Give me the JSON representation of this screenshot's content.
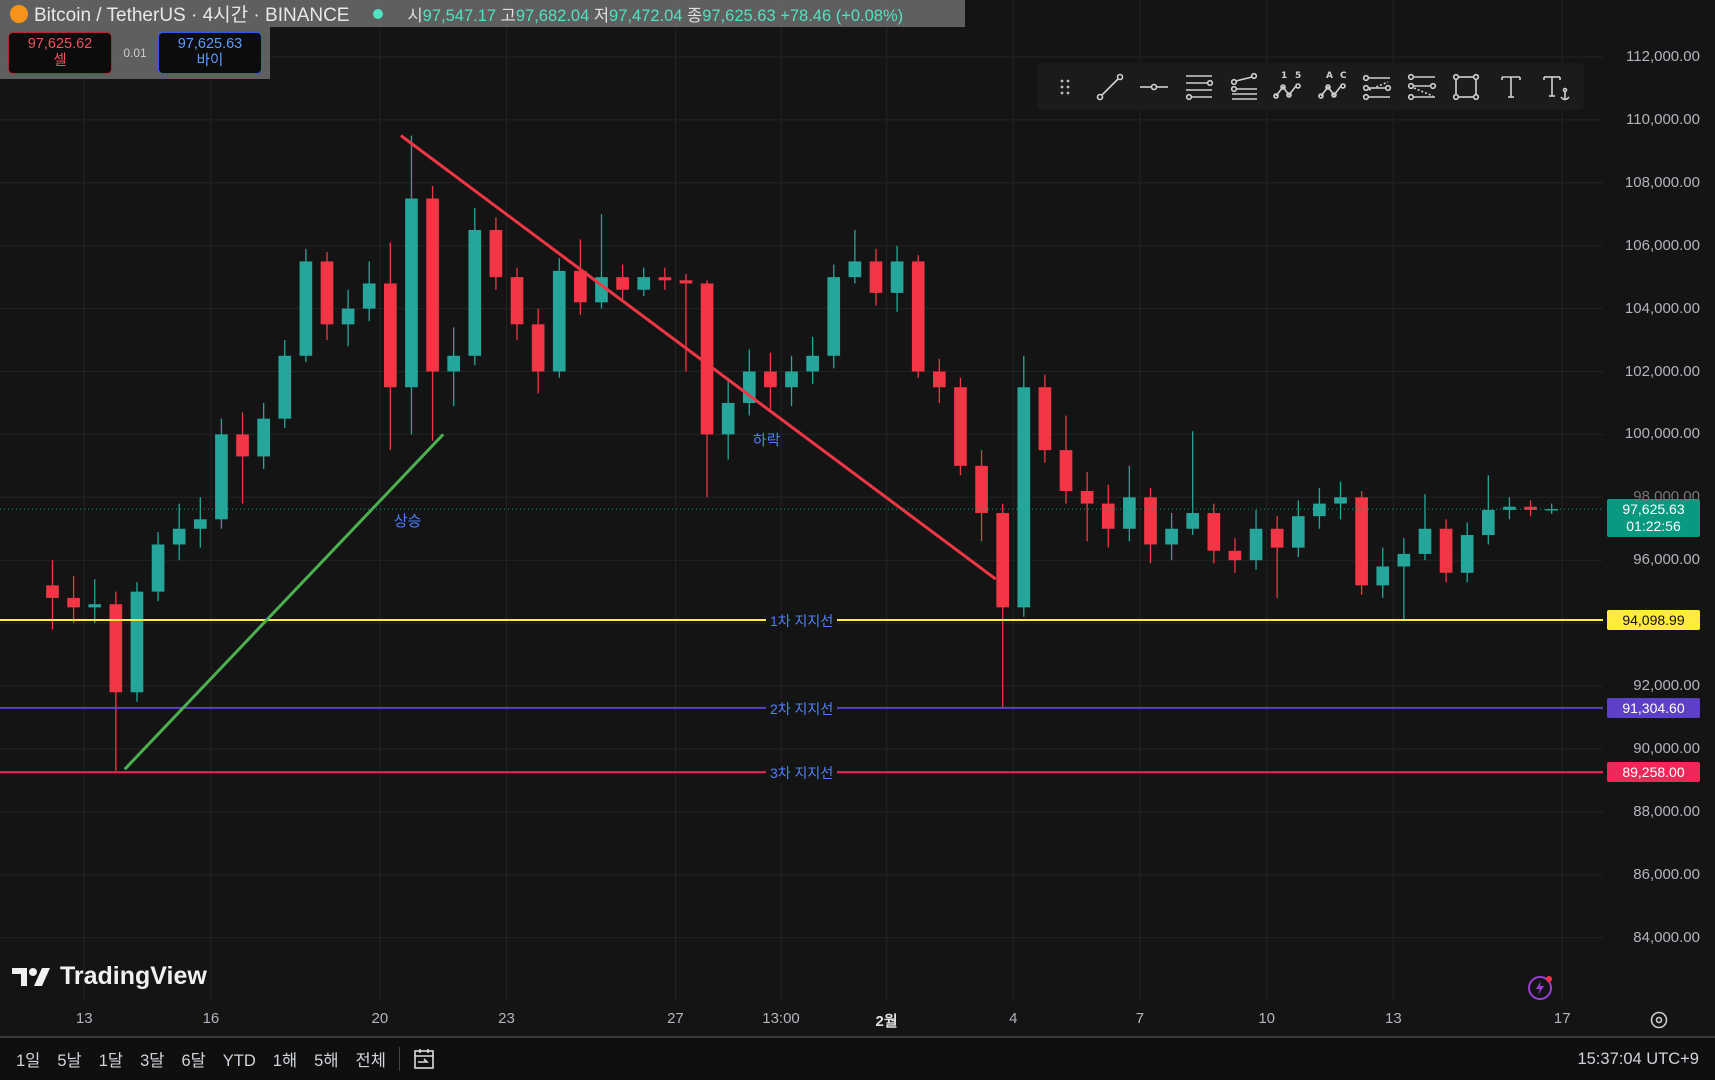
{
  "header": {
    "symbol": "Bitcoin / TetherUS · 4시간 · BINANCE",
    "o_label": "시",
    "o": "97,547.17",
    "h_label": "고",
    "h": "97,682.04",
    "l_label": "저",
    "l": "97,472.04",
    "c_label": "종",
    "c": "97,625.63",
    "change": "+78.46 (+0.08%)"
  },
  "trade": {
    "sell_price": "97,625.62",
    "sell_label": "셀",
    "spread": "0.01",
    "buy_price": "97,625.63",
    "buy_label": "바이"
  },
  "toolbar": {
    "icons": [
      "drag-handle-icon",
      "trend-line-icon",
      "horizontal-ray-icon",
      "parallel-channel-icon",
      "fib-retracement-icon",
      "elliott-wave-icon",
      "abcd-pattern-icon",
      "long-position-icon",
      "short-position-icon",
      "rectangle-icon",
      "text-icon",
      "anchored-text-icon"
    ]
  },
  "chart_data": {
    "type": "candlestick",
    "symbol": "BTCUSDT",
    "interval": "4시간",
    "ylim": [
      83000,
      113000
    ],
    "y_ticks": [
      "112,000.00",
      "110,000.00",
      "108,000.00",
      "106,000.00",
      "104,000.00",
      "102,000.00",
      "100,000.00",
      "98,000.00",
      "96,000.00",
      "92,000.00",
      "90,000.00",
      "88,000.00",
      "86,000.00",
      "84,000.00"
    ],
    "y_tick_values": [
      112000,
      110000,
      108000,
      106000,
      104000,
      102000,
      100000,
      98000,
      96000,
      92000,
      90000,
      88000,
      86000,
      84000
    ],
    "x_ticks": [
      {
        "label": "13",
        "date": "01-13 00:00"
      },
      {
        "label": "16",
        "date": "01-16 00:00"
      },
      {
        "label": "20",
        "date": "01-20 00:00"
      },
      {
        "label": "23",
        "date": "01-23 00:00"
      },
      {
        "label": "27",
        "date": "01-27 00:00"
      },
      {
        "label": "13:00",
        "date": "01-29 12:00"
      },
      {
        "label": "2월",
        "date": "02-01 00:00"
      },
      {
        "label": "4",
        "date": "02-04 00:00"
      },
      {
        "label": "7",
        "date": "02-07 00:00"
      },
      {
        "label": "10",
        "date": "02-10 00:00"
      },
      {
        "label": "13",
        "date": "02-13 00:00"
      },
      {
        "label": "17",
        "date": "02-17 00:00"
      }
    ],
    "colors": {
      "up": "#26a69a",
      "down": "#f23645"
    },
    "candles": [
      [
        "01-12 00:00",
        95200,
        96000,
        93800,
        94800
      ],
      [
        "01-12 12:00",
        94800,
        95500,
        94000,
        94500
      ],
      [
        "01-13 00:00",
        94500,
        95400,
        94000,
        94600
      ],
      [
        "01-13 12:00",
        94600,
        95000,
        89300,
        91800
      ],
      [
        "01-14 00:00",
        91800,
        95300,
        91500,
        95000
      ],
      [
        "01-14 12:00",
        95000,
        96900,
        94700,
        96500
      ],
      [
        "01-15 00:00",
        96500,
        97800,
        96000,
        97000
      ],
      [
        "01-15 12:00",
        97000,
        98000,
        96400,
        97300
      ],
      [
        "01-16 00:00",
        97300,
        100500,
        97000,
        100000
      ],
      [
        "01-16 12:00",
        100000,
        100700,
        97800,
        99300
      ],
      [
        "01-17 00:00",
        99300,
        101000,
        98900,
        100500
      ],
      [
        "01-17 12:00",
        100500,
        103000,
        100200,
        102500
      ],
      [
        "01-18 00:00",
        102500,
        105900,
        102300,
        105500
      ],
      [
        "01-18 12:00",
        105500,
        105800,
        103000,
        103500
      ],
      [
        "01-19 00:00",
        103500,
        104600,
        102800,
        104000
      ],
      [
        "01-19 12:00",
        104000,
        105500,
        103600,
        104800
      ],
      [
        "01-20 00:00",
        104800,
        106100,
        99500,
        101500
      ],
      [
        "01-20 12:00",
        101500,
        109500,
        100000,
        107500
      ],
      [
        "01-21 00:00",
        107500,
        107900,
        99800,
        102000
      ],
      [
        "01-21 12:00",
        102000,
        103400,
        100900,
        102500
      ],
      [
        "01-22 00:00",
        102500,
        107200,
        102200,
        106500
      ],
      [
        "01-22 12:00",
        106500,
        106900,
        104600,
        105000
      ],
      [
        "01-23 00:00",
        105000,
        105300,
        103000,
        103500
      ],
      [
        "01-23 12:00",
        103500,
        104000,
        101300,
        102000
      ],
      [
        "01-24 00:00",
        102000,
        105600,
        101800,
        105200
      ],
      [
        "01-24 12:00",
        105200,
        106200,
        103800,
        104200
      ],
      [
        "01-25 00:00",
        104200,
        107000,
        104000,
        105000
      ],
      [
        "01-25 12:00",
        105000,
        105400,
        104300,
        104600
      ],
      [
        "01-26 00:00",
        104600,
        105300,
        104400,
        105000
      ],
      [
        "01-26 12:00",
        105000,
        105300,
        104600,
        104900
      ],
      [
        "01-27 00:00",
        104900,
        105100,
        102000,
        104800
      ],
      [
        "01-27 12:00",
        104800,
        104900,
        98000,
        100000
      ],
      [
        "01-28 00:00",
        100000,
        101800,
        99200,
        101000
      ],
      [
        "01-28 12:00",
        101000,
        102700,
        100600,
        102000
      ],
      [
        "01-29 00:00",
        102000,
        102600,
        100800,
        101500
      ],
      [
        "01-29 12:00",
        101500,
        102500,
        100900,
        102000
      ],
      [
        "01-30 00:00",
        102000,
        103100,
        101600,
        102500
      ],
      [
        "01-30 12:00",
        102500,
        105400,
        102100,
        105000
      ],
      [
        "01-31 00:00",
        105000,
        106500,
        104800,
        105500
      ],
      [
        "01-31 12:00",
        105500,
        105900,
        104100,
        104500
      ],
      [
        "02-01 00:00",
        104500,
        106000,
        103900,
        105500
      ],
      [
        "02-01 12:00",
        105500,
        105700,
        101800,
        102000
      ],
      [
        "02-02 00:00",
        102000,
        102400,
        101000,
        101500
      ],
      [
        "02-02 12:00",
        101500,
        101800,
        98700,
        99000
      ],
      [
        "02-03 00:00",
        99000,
        99500,
        96600,
        97500
      ],
      [
        "02-03 12:00",
        97500,
        97800,
        91300,
        94500
      ],
      [
        "02-04 00:00",
        94500,
        102500,
        94200,
        101500
      ],
      [
        "02-04 12:00",
        101500,
        101900,
        99100,
        99500
      ],
      [
        "02-05 00:00",
        99500,
        100600,
        97800,
        98200
      ],
      [
        "02-05 12:00",
        98200,
        98800,
        96600,
        97800
      ],
      [
        "02-06 00:00",
        97800,
        98400,
        96400,
        97000
      ],
      [
        "02-06 12:00",
        97000,
        99000,
        96600,
        98000
      ],
      [
        "02-07 00:00",
        98000,
        98300,
        95900,
        96500
      ],
      [
        "02-07 12:00",
        96500,
        97500,
        96000,
        97000
      ],
      [
        "02-08 00:00",
        97000,
        100100,
        96800,
        97500
      ],
      [
        "02-08 12:00",
        97500,
        97800,
        95900,
        96300
      ],
      [
        "02-09 00:00",
        96300,
        96700,
        95600,
        96000
      ],
      [
        "02-09 12:00",
        96000,
        97600,
        95700,
        97000
      ],
      [
        "02-10 00:00",
        97000,
        97400,
        94800,
        96400
      ],
      [
        "02-10 12:00",
        96400,
        97900,
        96100,
        97400
      ],
      [
        "02-11 00:00",
        97400,
        98300,
        97000,
        97800
      ],
      [
        "02-11 12:00",
        97800,
        98500,
        97300,
        98000
      ],
      [
        "02-12 00:00",
        98000,
        98200,
        94900,
        95200
      ],
      [
        "02-12 12:00",
        95200,
        96400,
        94800,
        95800
      ],
      [
        "02-13 00:00",
        95800,
        96700,
        94100,
        96200
      ],
      [
        "02-13 12:00",
        96200,
        98100,
        96000,
        97000
      ],
      [
        "02-14 00:00",
        97000,
        97300,
        95300,
        95600
      ],
      [
        "02-14 12:00",
        95600,
        97200,
        95300,
        96800
      ],
      [
        "02-15 00:00",
        96800,
        98700,
        96500,
        97600
      ],
      [
        "02-15 12:00",
        97600,
        98000,
        97300,
        97700
      ],
      [
        "02-16 00:00",
        97700,
        97900,
        97400,
        97600
      ],
      [
        "02-16 12:00",
        97600,
        97800,
        97470,
        97625.63
      ]
    ],
    "trend_lines": [
      {
        "label": "상승",
        "color": "#4caf50",
        "from": [
          "01-13 23:00",
          89350
        ],
        "to": [
          "01-21 12:00",
          100000
        ],
        "label_at": [
          "01-20 00:00",
          97300
        ]
      },
      {
        "label": "하락",
        "color": "#f23645",
        "from": [
          "01-20 12:00",
          109500
        ],
        "to": [
          "02-03 14:00",
          95400
        ],
        "label_at": [
          "01-28 12:00",
          99900
        ]
      }
    ],
    "horizontal_lines": [
      {
        "label": "1차 지지선",
        "price": 94098.99,
        "price_label": "94,098.99",
        "color": "#ffeb3b",
        "text_color": "#111"
      },
      {
        "label": "2차 지지선",
        "price": 91304.6,
        "price_label": "91,304.60",
        "color": "#5e3fc7",
        "text_color": "#fff"
      },
      {
        "label": "3차 지지선",
        "price": 89258.0,
        "price_label": "89,258.00",
        "color": "#f0285a",
        "text_color": "#fff"
      }
    ],
    "last_price": {
      "price": 97625.63,
      "label": "97,625.63",
      "countdown": "01:22:56",
      "color": "#089981"
    }
  },
  "branding": {
    "name": "TradingView"
  },
  "bottom": {
    "ranges": [
      "1일",
      "5날",
      "1달",
      "3달",
      "6달",
      "YTD",
      "1해",
      "5해",
      "전체"
    ],
    "clock": "15:37:04 UTC+9"
  }
}
